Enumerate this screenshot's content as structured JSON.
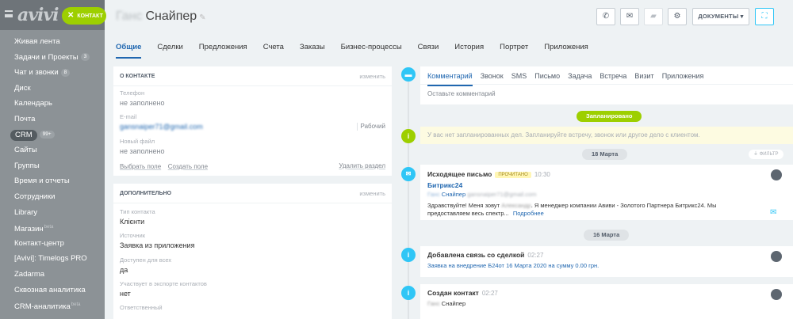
{
  "sidebar": {
    "logo": "avivi",
    "contact_button": "контакт",
    "items": [
      {
        "label": "Живая лента"
      },
      {
        "label": "Задачи и Проекты",
        "badge": "3"
      },
      {
        "label": "Чат и звонки",
        "badge": "8"
      },
      {
        "label": "Диск"
      },
      {
        "label": "Календарь"
      },
      {
        "label": "Почта"
      },
      {
        "label": "CRM",
        "badge": "99+",
        "active": true
      },
      {
        "label": "Сайты"
      },
      {
        "label": "Группы"
      },
      {
        "label": "Время и отчеты"
      },
      {
        "label": "Сотрудники"
      },
      {
        "label": "Library"
      },
      {
        "label": "Магазин",
        "sup": "beta"
      },
      {
        "label": "Контакт-центр"
      },
      {
        "label": "[Avivi]: Timelogs PRO"
      },
      {
        "label": "Zadarma"
      },
      {
        "label": "Сквозная аналитика"
      },
      {
        "label": "CRM-аналитика",
        "sup": "beta"
      }
    ]
  },
  "header": {
    "title_blurred": "Ганс",
    "title": "Снайпер",
    "documents_button": "Документы"
  },
  "tabs": [
    "Общие",
    "Сделки",
    "Предложения",
    "Счета",
    "Заказы",
    "Бизнес-процессы",
    "Связи",
    "История",
    "Портрет",
    "Приложения"
  ],
  "about": {
    "heading": "О контакте",
    "edit": "изменить",
    "phone_label": "Телефон",
    "phone_value": "не заполнено",
    "email_label": "E-mail",
    "email_value": "gansnaiper71@gmail.com",
    "email_type": "Рабочий",
    "file_label": "Новый файл",
    "file_value": "не заполнено",
    "choose_field": "Выбрать поле",
    "create_field": "Создать поле",
    "delete_section": "Удалить раздел"
  },
  "extra": {
    "heading": "Дополнительно",
    "edit": "изменить",
    "type_label": "Тип контакта",
    "type_value": "Клієнти",
    "source_label": "Источник",
    "source_value": "Заявка из приложения",
    "available_label": "Доступен для всех",
    "available_value": "да",
    "export_label": "Участвует в экспорте контактов",
    "export_value": "нет",
    "responsible_label": "Ответственный"
  },
  "timeline": {
    "comment_tabs": [
      "Комментарий",
      "Звонок",
      "SMS",
      "Письмо",
      "Задача",
      "Встреча",
      "Визит",
      "Приложения"
    ],
    "comment_placeholder": "Оставьте комментарий",
    "planned_label": "Запланировано",
    "planned_text": "У вас нет запланированных дел. Запланируйте встречу, звонок или другое дело с клиентом.",
    "date1": "18 Марта",
    "filter": "Фильтр",
    "email_event": {
      "title": "Исходящее письмо",
      "badge": "Прочитано",
      "time": "10:30",
      "subject": "Битрикс24",
      "from_blur": "Ганс",
      "from": "Снайпер",
      "from_email": "gansnaiper71@gmail.com",
      "body_start": "Здравствуйте! Меня зовут",
      "body_blur": "Александр",
      "body_end": ". Я менеджер компании Авиви - Золотого Партнера Битрикс24. Мы предоставляем весь спектр...",
      "more": "Подробнее"
    },
    "date2": "16 Марта",
    "link_event": {
      "title": "Добавлена связь со сделкой",
      "time": "02:27",
      "link": "Заявка на внедрение Б24от 16 Марта 2020 на сумму 0.00 грн."
    },
    "created_event": {
      "title": "Создан контакт",
      "time": "02:27",
      "name_blur": "Ганс",
      "name": "Снайпер"
    }
  }
}
